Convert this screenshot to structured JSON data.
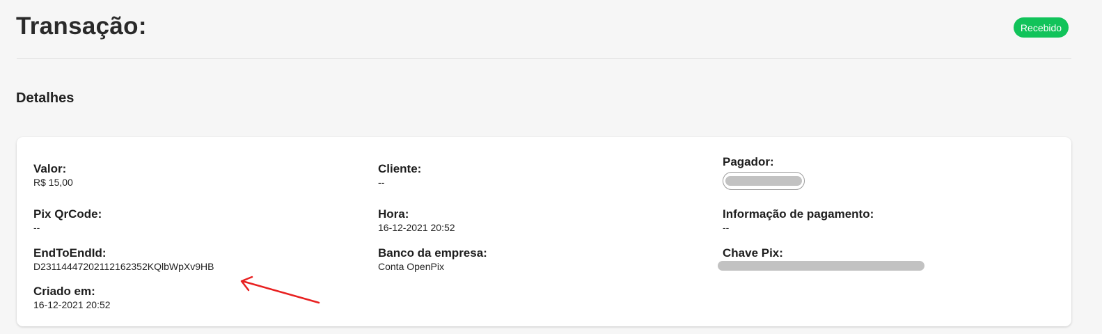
{
  "header": {
    "title": "Transação:",
    "status_badge": "Recebido",
    "badge_color": "#11c35a"
  },
  "section": {
    "title": "Detalhes"
  },
  "details": {
    "valor": {
      "label": "Valor:",
      "value": "R$ 15,00"
    },
    "cliente": {
      "label": "Cliente:",
      "value": "--"
    },
    "pagador": {
      "label": "Pagador:"
    },
    "pix_qrcode": {
      "label": "Pix QrCode:",
      "value": "--"
    },
    "hora": {
      "label": "Hora:",
      "value": "16-12-2021 20:52"
    },
    "info_pagamento": {
      "label": "Informação de pagamento:",
      "value": "--"
    },
    "end_to_end": {
      "label": "EndToEndId:",
      "value": "D23114447202112162352KQlbWpXv9HB"
    },
    "banco": {
      "label": "Banco da empresa:",
      "value": "Conta OpenPix"
    },
    "chave_pix": {
      "label": "Chave Pix:"
    },
    "criado_em": {
      "label": "Criado em:",
      "value": "16-12-2021 20:52"
    }
  },
  "annotation": {
    "arrow_color": "#e82020"
  }
}
